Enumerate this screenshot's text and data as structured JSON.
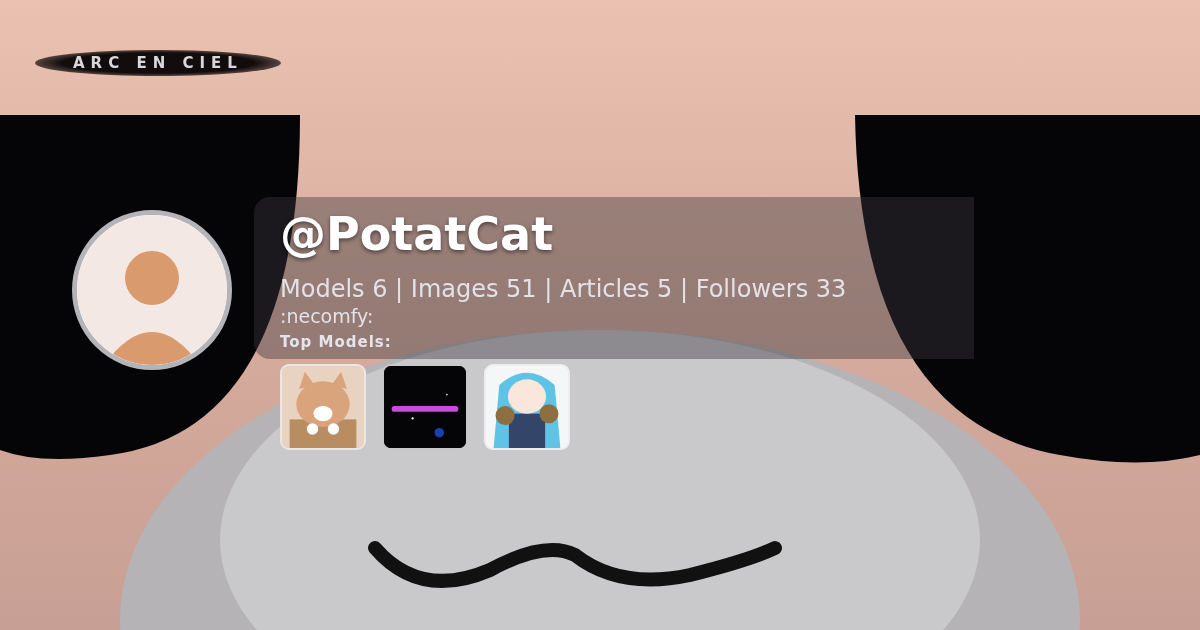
{
  "brand": "ARC EN CIEL",
  "profile": {
    "username": "@PotatCat",
    "stats": "Models 6 | Images 51 | Articles 5 | Followers 33",
    "bio": ":necomfy:",
    "top_models_label": "Top Models:"
  }
}
